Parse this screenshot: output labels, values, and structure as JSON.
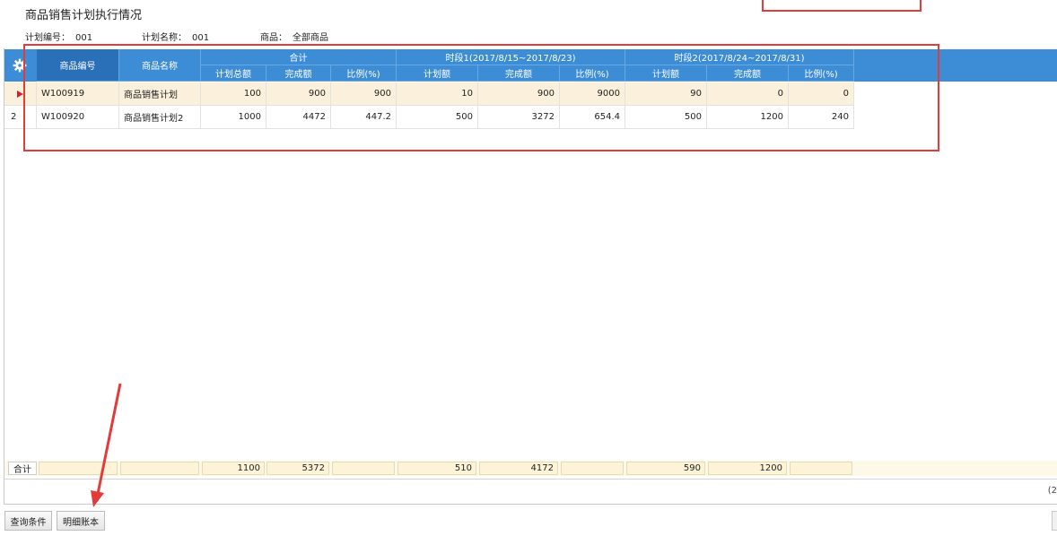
{
  "page": {
    "title": "商品销售计划执行情况"
  },
  "meta": [
    {
      "label": "计划编号：",
      "value": "001"
    },
    {
      "label": "计划名称：",
      "value": "001"
    },
    {
      "label": "商品：",
      "value": "全部商品"
    }
  ],
  "grid": {
    "settings_icon": "gear-icon",
    "headers": {
      "code": "商品编号",
      "name": "商品名称",
      "groups": [
        "合计",
        "时段1(2017/8/15~2017/8/23)",
        "时段2(2017/8/24~2017/8/31)"
      ],
      "sub": [
        "计划总额",
        "完成额",
        "比例(%)",
        "计划额",
        "完成额",
        "比例(%)",
        "计划额",
        "完成额",
        "比例(%)"
      ]
    },
    "rows": [
      {
        "index": "",
        "current": true,
        "code": "W100919",
        "name": "商品销售计划",
        "values": [
          "100",
          "900",
          "900",
          "10",
          "900",
          "9000",
          "90",
          "0",
          "0"
        ]
      },
      {
        "index": "2",
        "current": false,
        "code": "W100920",
        "name": "商品销售计划2",
        "values": [
          "1000",
          "4472",
          "447.2",
          "500",
          "3272",
          "654.4",
          "500",
          "1200",
          "240"
        ]
      }
    ],
    "summary": {
      "label": "合计",
      "values": [
        "1100",
        "5372",
        "",
        "510",
        "4172",
        "",
        "590",
        "1200",
        ""
      ]
    },
    "pager_text": "(2"
  },
  "buttons": {
    "query": "查询条件",
    "detail": "明细账本"
  },
  "colors": {
    "header_bg": "#3d8dd6",
    "selected_row": "#fbf0dc",
    "annotation": "#e23b3b"
  }
}
